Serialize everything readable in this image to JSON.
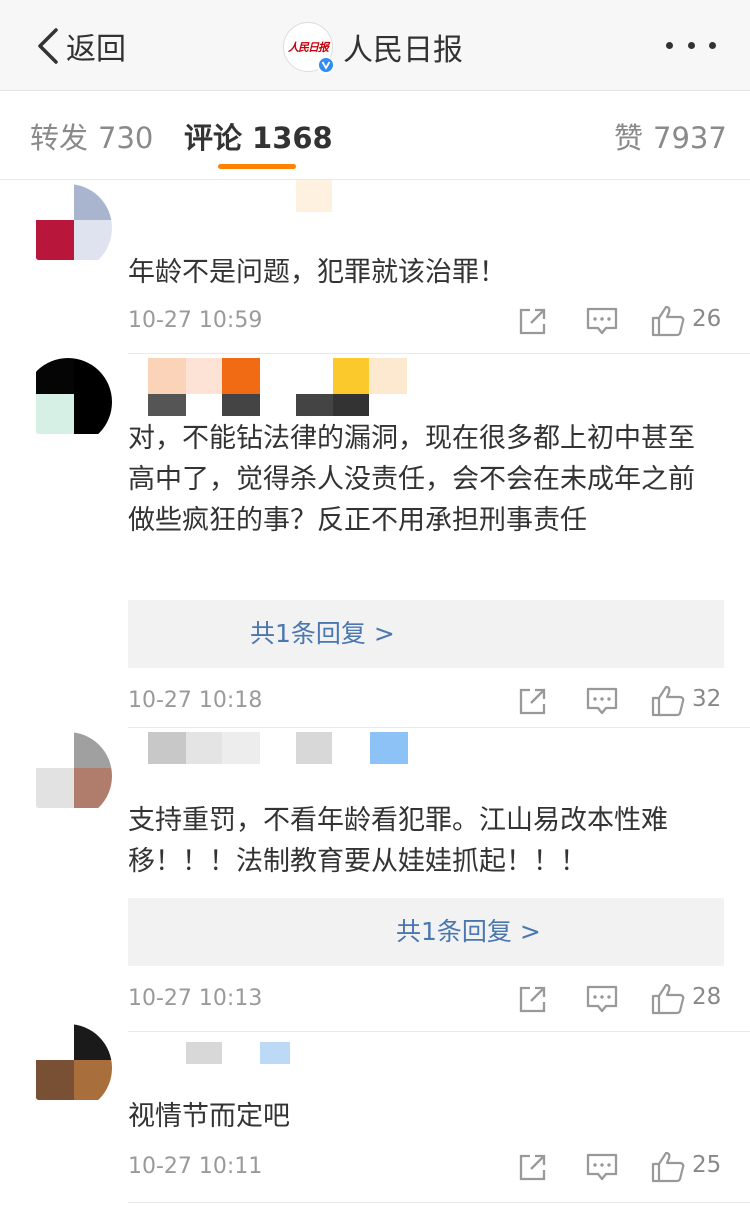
{
  "nav": {
    "back_label": "返回",
    "title": "人民日报",
    "logo_text": "人民日报"
  },
  "tabs": {
    "repost": {
      "label": "转发",
      "count": "730"
    },
    "comment": {
      "label": "评论",
      "count": "1368"
    },
    "like": {
      "label": "赞",
      "count": "7937"
    }
  },
  "comments": [
    {
      "text": "年龄不是问题，犯罪就该治罪！",
      "time": "10-27 10:59",
      "likes": "26"
    },
    {
      "text": "对，不能钻法律的漏洞，现在很多都上初中甚至高中了，觉得杀人没责任，会不会在未成年之前做些疯狂的事？反正不用承担刑事责任",
      "reply_label": "共1条回复 >",
      "time": "10-27 10:18",
      "likes": "32"
    },
    {
      "text": "支持重罚，不看年龄看犯罪。江山易改本性难移！！！法制教育要从娃娃抓起！！！",
      "reply_label": "共1条回复 >",
      "time": "10-27 10:13",
      "likes": "28"
    },
    {
      "text": "视情节而定吧",
      "time": "10-27 10:11",
      "likes": "25"
    }
  ],
  "colors": {
    "accent": "#ff8200",
    "link": "#4a77b0",
    "verified": "#2f8df5"
  },
  "icons": [
    "back-chevron-icon",
    "verified-badge-icon",
    "more-dots-icon",
    "share-icon",
    "comment-icon",
    "like-thumb-icon"
  ]
}
